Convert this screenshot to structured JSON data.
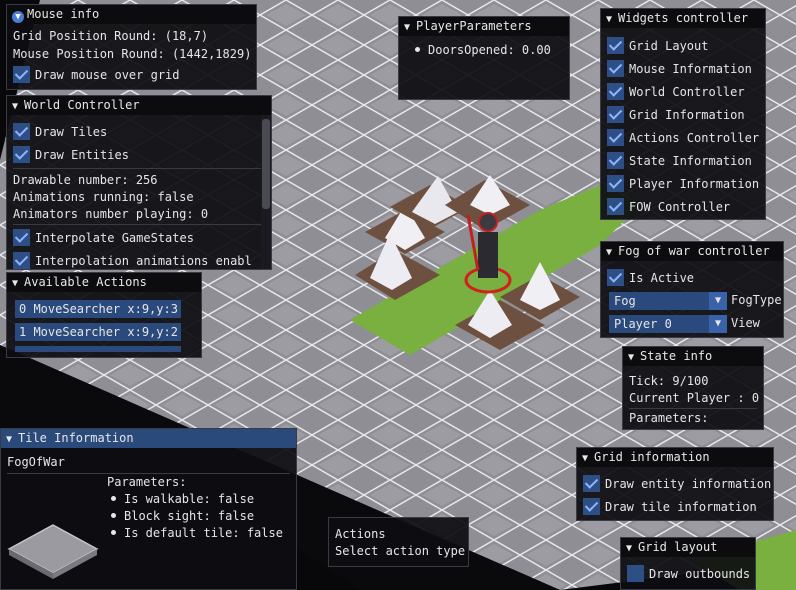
{
  "mouse_info": {
    "title": "Mouse info",
    "grid_pos": "Grid Position Round: (18,7)",
    "mouse_pos": "Mouse Position Round: (1442,1829)",
    "draw_mouse": "Draw mouse over grid"
  },
  "player_params": {
    "title": "PlayerParameters",
    "doors": "DoorsOpened: 0.00"
  },
  "widgets": {
    "title": "Widgets controller",
    "items": [
      "Grid Layout",
      "Mouse Information",
      "World Controller",
      "Grid Information",
      "Actions Controller",
      "State Information",
      "Player Information",
      "FOW Controller"
    ]
  },
  "world_ctrl": {
    "title": "World Controller",
    "draw_tiles": "Draw Tiles",
    "draw_entities": "Draw Entities",
    "drawable": "Drawable number: 256",
    "anim_running": "Animations running: false",
    "animators": "Animators number playing: 0",
    "interp_states": "Interpolate GameStates",
    "interp_anim": "Interpolation animations enabled"
  },
  "actions": {
    "title": "Available Actions",
    "items": [
      "0 MoveSearcher x:9,y:3",
      "1 MoveSearcher x:9,y:2"
    ]
  },
  "fow": {
    "title": "Fog of war controller",
    "active": "Is Active",
    "fog_value": "Fog",
    "fog_label": "FogType",
    "player_value": "Player 0",
    "view_label": "View"
  },
  "state_info": {
    "title": "State info",
    "tick": "Tick: 9/100",
    "player": "Current Player : 0",
    "params": "Parameters:"
  },
  "tile_info": {
    "title": "Tile Information",
    "name": "FogOfWar",
    "params_label": "Parameters:",
    "params": [
      "Is walkable: false",
      "Block sight: false",
      "Is default tile: false"
    ]
  },
  "actions_tip": {
    "title": "Actions",
    "hint": "Select action type"
  },
  "grid_info": {
    "title": "Grid information",
    "entity": "Draw entity information",
    "tile": "Draw tile information"
  },
  "grid_layout": {
    "title": "Grid layout",
    "outbounds": "Draw outbounds"
  },
  "colors": {
    "accent": "#4c7dd6",
    "checkbox": "#2e4f86",
    "active_title": "#294a7a",
    "grass": "#6fa23a"
  }
}
